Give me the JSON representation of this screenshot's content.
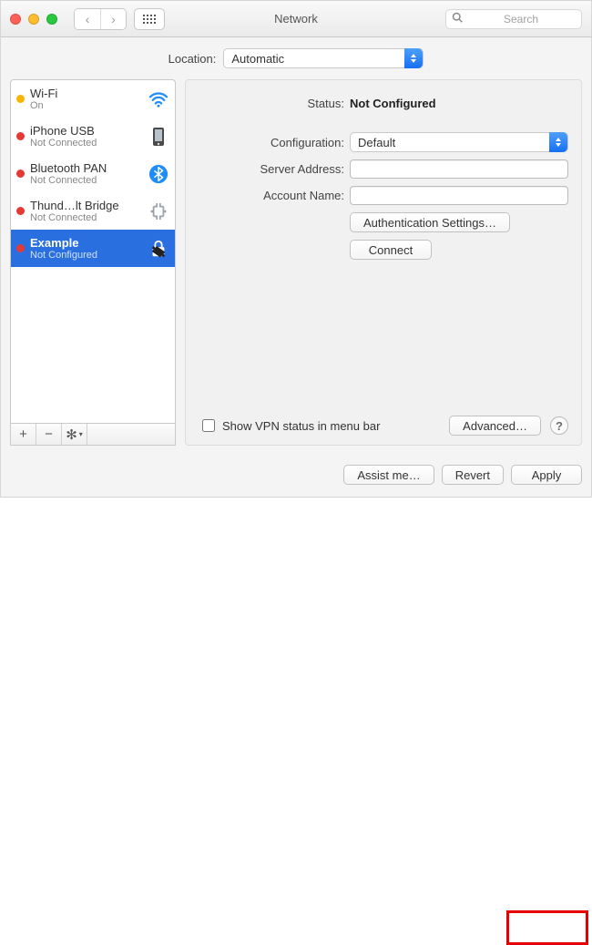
{
  "title": "Network",
  "search_placeholder": "Search",
  "location": {
    "label": "Location:",
    "value": "Automatic"
  },
  "sidebar": {
    "items": [
      {
        "name": "Wi-Fi",
        "status": "On",
        "dot": "yellow",
        "icon": "wifi"
      },
      {
        "name": "iPhone USB",
        "status": "Not Connected",
        "dot": "red",
        "icon": "phone"
      },
      {
        "name": "Bluetooth PAN",
        "status": "Not Connected",
        "dot": "red",
        "icon": "bluetooth"
      },
      {
        "name": "Thund…lt Bridge",
        "status": "Not Connected",
        "dot": "red",
        "icon": "thunderbolt"
      },
      {
        "name": "Example",
        "status": "Not Configured",
        "dot": "red",
        "icon": "vpn",
        "selected": true
      }
    ]
  },
  "detail": {
    "status_label": "Status:",
    "status_value": "Not Configured",
    "config_label": "Configuration:",
    "config_value": "Default",
    "server_label": "Server Address:",
    "server_value": "",
    "account_label": "Account Name:",
    "account_value": "",
    "auth_button": "Authentication Settings…",
    "connect_button": "Connect",
    "show_vpn_label": "Show VPN status in menu bar",
    "show_vpn_checked": false,
    "advanced_button": "Advanced…"
  },
  "buttons": {
    "assist": "Assist me…",
    "revert": "Revert",
    "apply": "Apply"
  }
}
